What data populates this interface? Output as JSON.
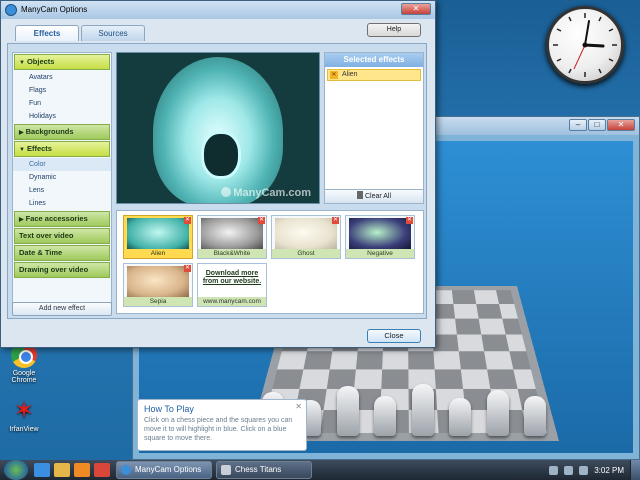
{
  "manycam": {
    "title": "ManyCam Options",
    "tabs": [
      {
        "label": "Effects",
        "active": true
      },
      {
        "label": "Sources",
        "active": false
      }
    ],
    "help_label": "Help",
    "close_label": "Close",
    "add_effect_label": "Add new effect",
    "menu": [
      {
        "label": "Objects",
        "open": true,
        "subs": [
          "Avatars",
          "Flags",
          "Fun",
          "Holidays"
        ]
      },
      {
        "label": "Backgrounds",
        "open": false
      },
      {
        "label": "Effects",
        "open": true,
        "subs": [
          "Color",
          "Dynamic",
          "Lens",
          "Lines"
        ],
        "selected_sub": "Color"
      },
      {
        "label": "Face accessories",
        "open": false
      },
      {
        "label": "Text over video",
        "open": false
      },
      {
        "label": "Date & Time",
        "open": false
      },
      {
        "label": "Drawing over video",
        "open": false
      }
    ],
    "preview_watermark": "ManyCam.com",
    "selected_effects": {
      "header": "Selected effects",
      "items": [
        "Alien"
      ],
      "clear_all": "Clear All"
    },
    "effects_grid": [
      {
        "label": "Alien",
        "selected": true,
        "color": "#5fd8cc"
      },
      {
        "label": "Black&White",
        "selected": false,
        "color": "#9a9a9a"
      },
      {
        "label": "Ghost",
        "selected": false,
        "color": "#e8e2cf"
      },
      {
        "label": "Negative",
        "selected": false,
        "color": "#3b3f7a"
      },
      {
        "label": "Sepia",
        "selected": false,
        "color": "#d8b48a"
      }
    ],
    "download": {
      "line1": "Download more",
      "line2": "from our website.",
      "url": "www.manycam.com"
    }
  },
  "chess": {
    "how_to_play": {
      "title": "How To Play",
      "text": "Click on a chess piece and the squares you can move it to will highlight in blue. Click on a blue square to move there."
    }
  },
  "desktop": {
    "icons": [
      {
        "label": "Google Chrome"
      },
      {
        "label": "IrfanView"
      }
    ]
  },
  "taskbar": {
    "tasks": [
      {
        "label": "ManyCam Options",
        "active": true
      },
      {
        "label": "Chess Titans",
        "active": false
      }
    ],
    "clock": "3:02 PM"
  },
  "colors": {
    "accent_green": "#9fca5c",
    "accent_blue": "#7fb1e2",
    "selected_yellow": "#ffd94f"
  }
}
